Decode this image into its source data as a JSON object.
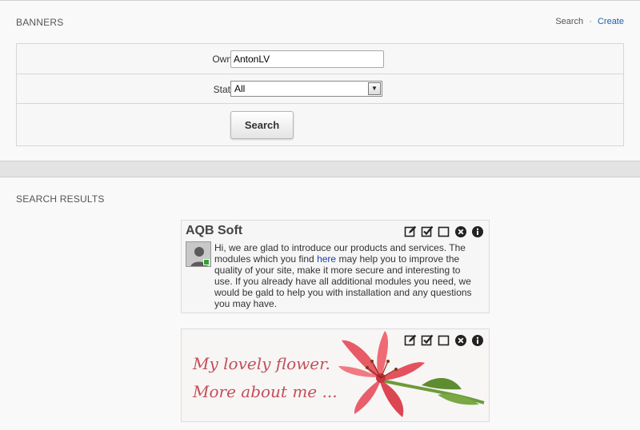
{
  "search_panel": {
    "title": "BANNERS",
    "links": {
      "search": "Search",
      "separator": "·",
      "create": "Create"
    },
    "owner_label": "Owner:",
    "owner_value": "AntonLV",
    "status_label": "Status:",
    "status_value": "All",
    "search_button": "Search"
  },
  "results_panel": {
    "title": "SEARCH RESULTS",
    "banners": [
      {
        "title": "AQB Soft",
        "text_before_link": "Hi, we are glad to introduce our products and services. The modules which you find ",
        "link_text": "here",
        "text_after_link": " may help you to improve the quality of your site, make it more secure and interesting to use. If you already have all additional modules you need, we would be gald to help you with installation and any questions you may have.",
        "avatar_status_color": "#2fa42f"
      },
      {
        "image_text_line1": "My lovely flower.",
        "image_text_line2": "More about me ..."
      }
    ],
    "actions": [
      "edit-icon",
      "approve-icon",
      "checkbox-icon",
      "delete-icon",
      "info-icon"
    ]
  },
  "colors": {
    "link": "#1a5fb4",
    "panel_bg": "#f9f9f9",
    "gap_bg": "#e3e3e3",
    "flower_text": "#c2505a"
  }
}
